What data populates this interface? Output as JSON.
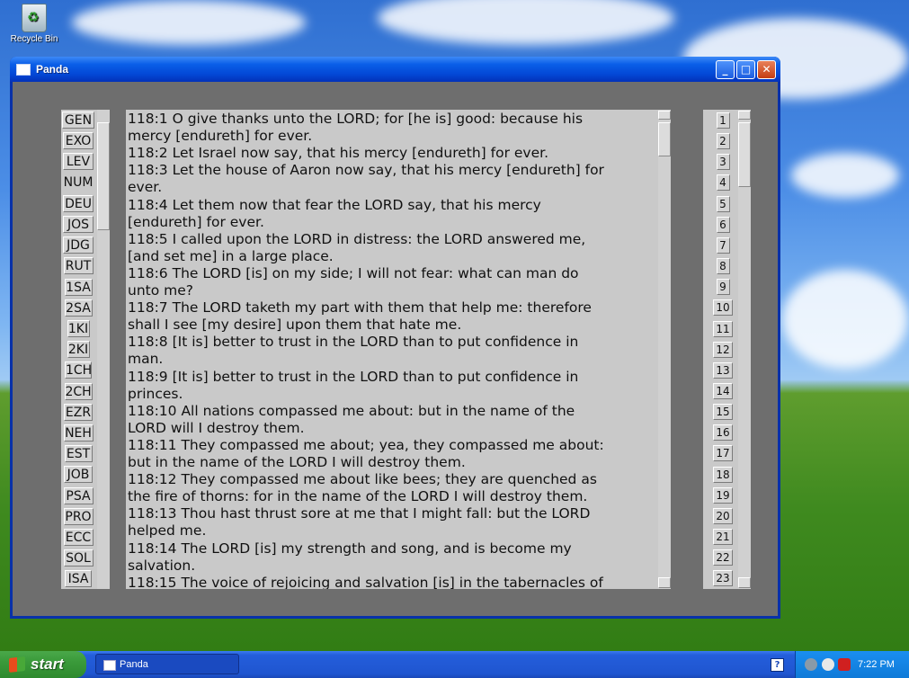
{
  "desktop": {
    "icons": [
      {
        "label": "Recycle Bin",
        "icon": "recycle-bin-icon"
      }
    ]
  },
  "window": {
    "title": "Panda",
    "controls": {
      "minimize": "minimize-icon",
      "maximize": "maximize-icon",
      "close": "close-icon"
    }
  },
  "books": [
    "GEN",
    "EXO",
    "LEV",
    "NUM",
    "DEU",
    "JOS",
    "JDG",
    "RUT",
    "1SA",
    "2SA",
    "1KI",
    "2KI",
    "1CH",
    "2CH",
    "EZR",
    "NEH",
    "EST",
    "JOB",
    "PSA",
    "PRO",
    "ECC",
    "SOL",
    "ISA"
  ],
  "selected_book": "NUM",
  "verses": [
    "118:1 O give thanks unto the LORD; for [he is] good: because his",
    "mercy [endureth] for ever.",
    "118:2 Let Israel now say, that his mercy [endureth] for ever.",
    "118:3 Let the house of Aaron now say, that his mercy [endureth] for",
    "ever.",
    "118:4 Let them now that fear the LORD say, that his mercy",
    "[endureth] for ever.",
    "118:5 I called upon the LORD in distress: the LORD answered me,",
    "[and set me] in a large place.",
    "118:6 The LORD [is] on my side; I will not fear: what can man do",
    "unto me?",
    "118:7 The LORD taketh my part with them that help me: therefore",
    "shall I see [my desire] upon them that hate me.",
    "118:8 [It is] better to trust in the LORD than to put confidence in",
    "man.",
    "118:9 [It is] better to trust in the LORD than to put confidence in",
    "princes.",
    "118:10 All nations compassed me about: but in the name of the",
    "LORD will I destroy them.",
    "118:11 They compassed me about; yea, they compassed me about:",
    "but in the name of the LORD I will destroy them.",
    "118:12 They compassed me about like bees; they are quenched as",
    "the fire of thorns: for in the name of the LORD I will destroy them.",
    "118:13 Thou hast thrust sore at me that I might fall: but the LORD",
    "helped me.",
    "118:14 The LORD [is] my strength and song, and is become my",
    "salvation.",
    "118:15 The voice of rejoicing and salvation [is] in the tabernacles of"
  ],
  "chapters": [
    "1",
    "2",
    "3",
    "4",
    "5",
    "6",
    "7",
    "8",
    "9",
    "10",
    "11",
    "12",
    "13",
    "14",
    "15",
    "16",
    "17",
    "18",
    "19",
    "20",
    "21",
    "22",
    "23"
  ],
  "taskbar": {
    "start_label": "start",
    "task_label": "Panda",
    "help_label": "?",
    "clock": "7:22 PM"
  },
  "colors": {
    "window_frame": "#0a48c8",
    "client_bg": "#6e6e6e",
    "list_bg": "#c9c9c9",
    "taskbar": "#245edb",
    "start_button": "#3a9a3a"
  }
}
